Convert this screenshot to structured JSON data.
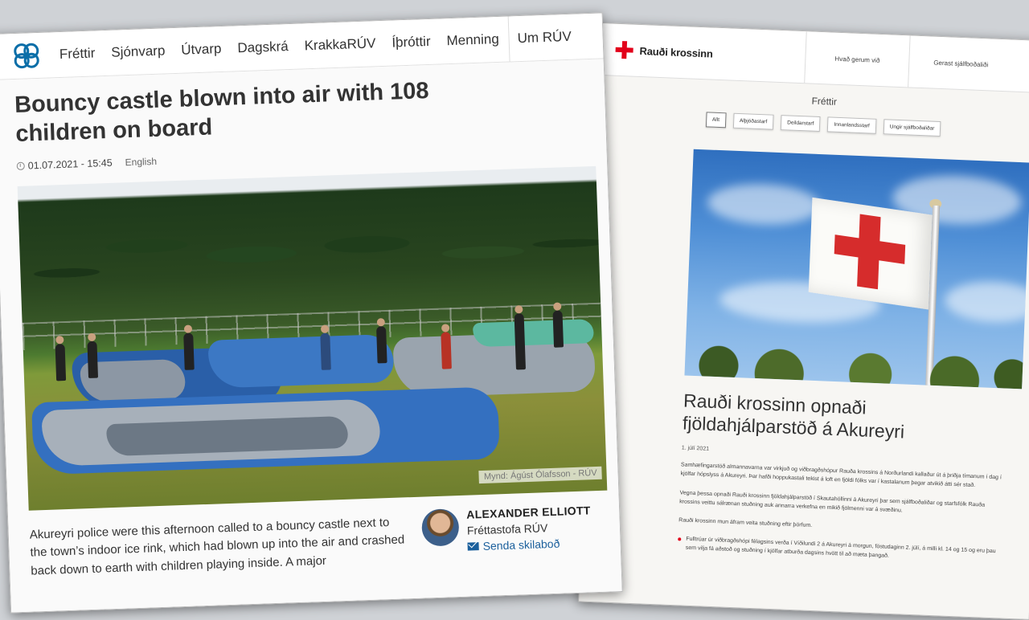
{
  "ruv": {
    "nav": [
      "Fréttir",
      "Sjónvarp",
      "Útvarp",
      "Dagskrá",
      "KrakkaRÚV",
      "Íþróttir",
      "Menning",
      "Um RÚV"
    ],
    "title": "Bouncy castle blown into air with 108 children on board",
    "date": "01.07.2021 - 15:45",
    "language": "English",
    "photo_credit": "Mynd: Ágúst Ólafsson - RÚV",
    "lead": "Akureyri police were this afternoon called to a bouncy castle next to the town’s indoor ice rink, which had blown up into the air and crashed back down to earth with children playing inside. A major",
    "author": {
      "name": "ALEXANDER ELLIOTT",
      "org": "Fréttastofa RÚV",
      "mail": "Senda skilaboð"
    }
  },
  "rk": {
    "logo": "Rauði krossinn",
    "nav": [
      "Hvað gerum við",
      "Gerast sjálfboðaliði"
    ],
    "section": "Fréttir",
    "filters": [
      "Allt",
      "Alþjóðastarf",
      "Deildarstarf",
      "Innanlandsstarf",
      "Ungir sjálfboðaliðar"
    ],
    "title": "Rauði krossinn opnaði fjöldahjálparstöð á Akureyri",
    "date": "1. júlí 2021",
    "paragraphs": [
      "Samhæfingarstöð almannavarna var virkjuð og viðbragðshópur Rauða krossins á Norðurlandi kallaður út á þriðja tímanum í dag í kjölfar hópslyss á Akureyri. Þar hafði hoppukastali tekist á loft en fjöldi fólks var í kastalanum þegar atvikið átti sér stað.",
      "Vegna þessa opnaði Rauði krossinn fjöldahjálparstöð í Skautahöllinni á Akureyri þar sem sjálfboðaliðar og starfsfólk Rauða krossins veittu sálrænan stuðning auk annarra verkefna en mikið fjölmenni var á svæðinu.",
      "Rauði krossinn mun áfram veita stuðning eftir þörfum."
    ],
    "bullet": "Fulltrúar úr viðbragðshópi félagsins verða í Víðilundi 2 á Akureyri á morgun, föstudaginn 2. júlí, á milli kl. 14 og 15 og eru þau sem vilja fá aðstoð og stuðning í kjölfar atburða dagsins hvött til að mæta þangað."
  },
  "colors": {
    "ruv_accent": "#0a6ea8",
    "rk_red": "#e2001a",
    "link": "#1a5f9c"
  }
}
